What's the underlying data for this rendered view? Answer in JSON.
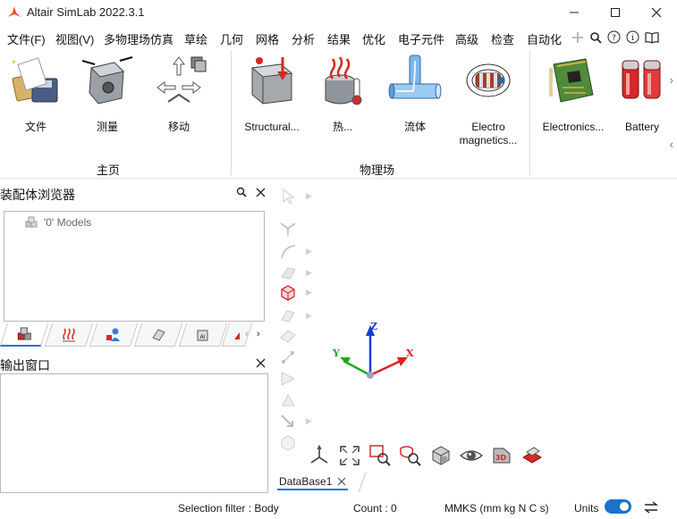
{
  "window": {
    "title": "Altair SimLab 2022.3.1",
    "accent_color": "#1a73c8",
    "logo_color": "#e4572e"
  },
  "menu": {
    "items": [
      "文件(F)",
      "视图(V)",
      "多物理场仿真",
      "草绘",
      "几何",
      "网格",
      "分析",
      "结果",
      "优化",
      "电子元件",
      "高级",
      "检查",
      "自动化"
    ],
    "active_index": 2
  },
  "ribbon": {
    "groups": [
      {
        "label": "主页",
        "buttons": [
          {
            "label": "文件",
            "icon": "file-icon"
          },
          {
            "label": "测量",
            "icon": "measure-icon"
          },
          {
            "label": "移动",
            "icon": "move-icon"
          }
        ]
      },
      {
        "label": "物理场",
        "buttons": [
          {
            "label": "Structural...",
            "icon": "structural-icon"
          },
          {
            "label": "热...",
            "icon": "thermal-icon"
          },
          {
            "label": "流体",
            "icon": "fluid-icon"
          },
          {
            "label": "Electro magnetics...",
            "icon": "electromagnetics-icon"
          }
        ]
      },
      {
        "label": "",
        "buttons": [
          {
            "label": "Electronics...",
            "icon": "electronics-icon"
          },
          {
            "label": "Battery",
            "icon": "battery-icon"
          }
        ]
      }
    ]
  },
  "assembly_browser": {
    "title": "装配体浏览器",
    "tree_root": "'0' Models"
  },
  "output_window": {
    "title": "输出窗口"
  },
  "viewport": {
    "axes": {
      "x": "X",
      "y": "Y",
      "z": "Z"
    },
    "axis_colors": {
      "x": "#e02020",
      "y": "#1faa1f",
      "z": "#1a3bd6"
    },
    "database_tab": "DataBase1"
  },
  "status": {
    "selection_filter": "Selection filter : Body",
    "count": "Count : 0",
    "units_system": "MMKS (mm kg N C s)",
    "units_label": "Units",
    "units_toggle_on": true
  }
}
